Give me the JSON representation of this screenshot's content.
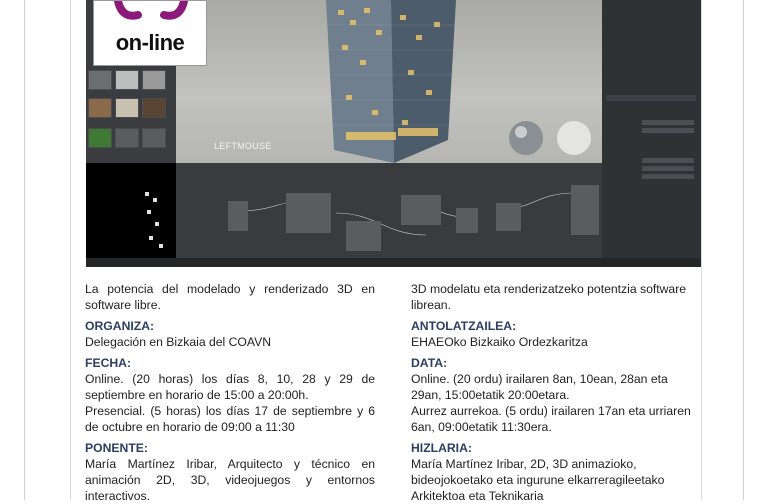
{
  "logo": {
    "text": "on-line",
    "brand_color": "#8b1a7a"
  },
  "screenshot": {
    "viewport_label": "LEFTMOUSE"
  },
  "left": {
    "intro": "La potencia del modelado y renderizado 3D en software libre.",
    "organiza_heading": "ORGANIZA:",
    "organiza_text": "Delegación en Bizkaia del COAVN",
    "fecha_heading": "FECHA:",
    "fecha_online": "Online. (20 horas) los días 8, 10, 28 y 29 de septiembre en horario de 15:00 a 20:00h.",
    "fecha_presencial": "Presencial. (5 horas) los días 17 de septiembre y 6 de octubre en horario de 09:00 a 11:30",
    "ponente_heading": "PONENTE:",
    "ponente_text": "María Martínez Iribar, Arquitecto y técnico en animación 2D, 3D, videojuegos y entornos interactivos."
  },
  "right": {
    "intro": "3D modelatu eta renderizatzeko potentzia software librean.",
    "antolatzailea_heading": "ANTOLATZAILEA:",
    "antolatzailea_text": "EHAEOko Bizkaiko Ordezkaritza",
    "data_heading": "DATA:",
    "data_online": "Online. (20 ordu) irailaren 8an, 10ean, 28an eta 29an, 15:00etatik 20:00etara.",
    "data_aurrez": "Aurrez aurrekoa. (5 ordu) irailaren 17an eta urriaren 6an, 09:00etatik 11:30era.",
    "hizlaria_heading": "HIZLARIA:",
    "hizlaria_text": "María Martínez Iribar, 2D, 3D animazioko, bideojokoetako eta ingurune elkarreragileetako Arkitektoa eta Teknikaria"
  }
}
